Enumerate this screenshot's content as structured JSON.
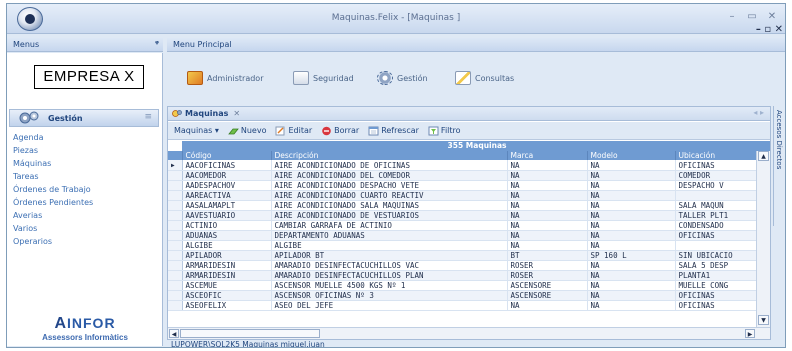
{
  "window": {
    "title": "Maquinas.Felix - [Maquinas ]",
    "minimize": "–",
    "maximize": "▭",
    "close": "✕"
  },
  "mdi": {
    "minimize": "–",
    "restore": "▫",
    "close": "✕"
  },
  "left": {
    "header": "Menus",
    "company": "EMPRESA X",
    "section": "Gestión",
    "nav": [
      "Agenda",
      "Piezas",
      "Máquinas",
      "Tareas",
      "Órdenes de Trabajo",
      "Órdenes Pendientes",
      "Averias",
      "Varios",
      "Operarios"
    ],
    "brand": {
      "first": "A",
      "rest": "INFOR",
      "tagline": "Assessors Informàtics"
    }
  },
  "main": {
    "header": "Menu Principal",
    "ribbon": [
      "Administrador",
      "Seguridad",
      "Gestión",
      "Consultas"
    ]
  },
  "doc": {
    "tab": "Maquinas",
    "tab_close": "✕",
    "arrows": "◂ ▸",
    "toolbar": {
      "dropdown": "Maquinas ▾",
      "nuevo": "Nuevo",
      "editar": "Editar",
      "borrar": "Borrar",
      "refrescar": "Refrescar",
      "filtro": "Filtro"
    },
    "grid": {
      "caption": "355 Maquinas",
      "columns": [
        "Código",
        "Descripción",
        "Marca",
        "Modelo",
        "Ubicación"
      ],
      "rows": [
        [
          "AACOFICINAS",
          "AIRE ACONDICIONADO DE OFICINAS",
          "NA",
          "NA",
          "OFICINAS"
        ],
        [
          "AACOMEDOR",
          "AIRE ACONDICIONADO DEL COMEDOR",
          "NA",
          "NA",
          "COMEDOR"
        ],
        [
          "AADESPACHOV",
          "AIRE ACONDICIONADO DESPACHO VETE",
          "NA",
          "NA",
          "DESPACHO V"
        ],
        [
          "AAREACTIVA",
          "AIRE ACONDICIONADO CUARTO REACTIV",
          "NA",
          "NA",
          ""
        ],
        [
          "AASALAMAPLT",
          "AIRE ACONDICIONADO SALA MAQUINAS",
          "NA",
          "NA",
          "SALA MAQUN"
        ],
        [
          "AAVESTUARIO",
          "AIRE ACONDICIONADO DE VESTUARIOS",
          "NA",
          "NA",
          "TALLER PLT1"
        ],
        [
          "ACTINIO",
          "CAMBIAR GARRAFA DE ACTINIO",
          "NA",
          "NA",
          "CONDENSADO"
        ],
        [
          "ADUANAS",
          "DEPARTAMENTO ADUANAS",
          "NA",
          "NA",
          "OFICINAS"
        ],
        [
          "ALGIBE",
          "ALGIBE",
          "NA",
          "NA",
          ""
        ],
        [
          "APILADOR",
          "APILADOR BT",
          "BT",
          "SP 160 L",
          "SIN UBICACIO"
        ],
        [
          "ARMARIDESIN",
          "AMARADIO DESINFECTACUCHILLOS VAC",
          "ROSER",
          "NA",
          "SALA 5 DESP"
        ],
        [
          "ARMARIDESIN",
          "AMARADIO DESINFECTACUCHILLOS PLAN",
          "ROSER",
          "NA",
          "PLANTA1"
        ],
        [
          "ASCEMUE",
          "ASCENSOR MUELLE 4500 KGS Nº 1",
          "ASCENSORE",
          "NA",
          "MUELLE CONG"
        ],
        [
          "ASCEOFIC",
          "ASCENSOR OFICINAS Nº 3",
          "ASCENSORE",
          "NA",
          "OFICINAS"
        ],
        [
          "ASEOFELIX",
          "ASEO DEL JEFE",
          "NA",
          "NA",
          "OFICINAS"
        ]
      ]
    }
  },
  "sidestrip": "Accesos Directos",
  "status": "LUPOWER\\SQL2K5 Maquinas miguel.juan"
}
